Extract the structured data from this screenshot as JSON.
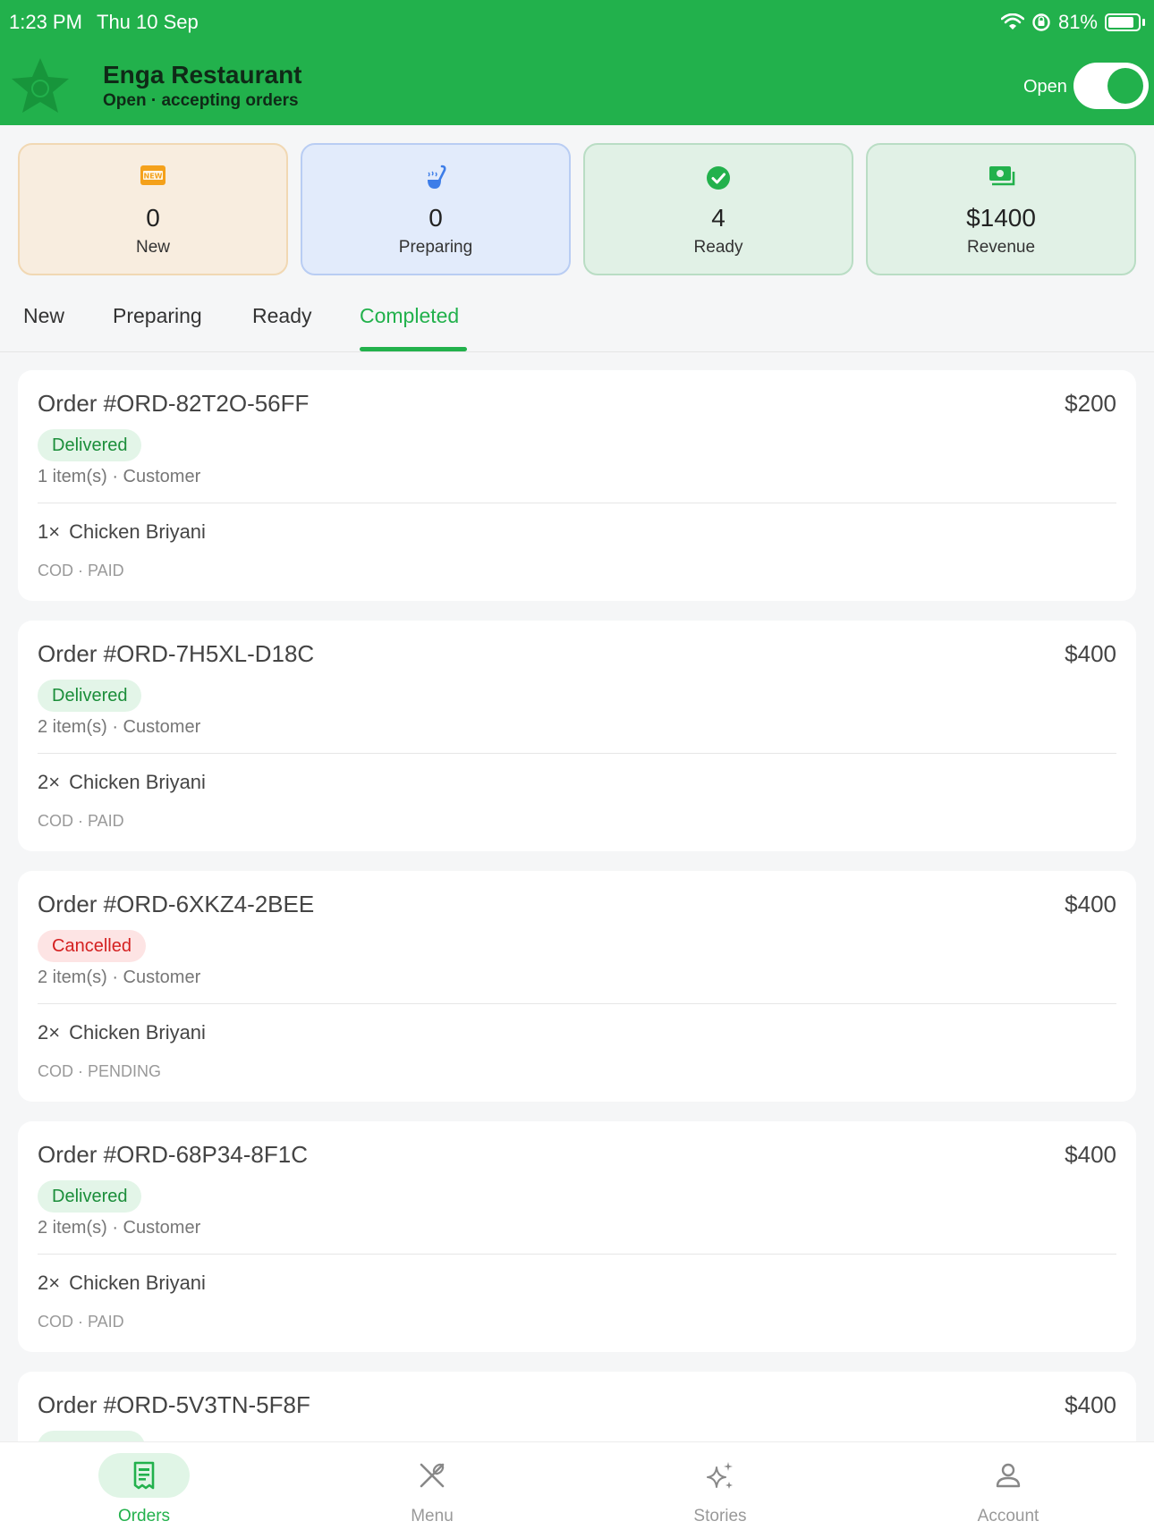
{
  "status_bar": {
    "time": "1:23 PM",
    "date": "Thu 10 Sep",
    "battery": "81%"
  },
  "header": {
    "name": "Enga Restaurant",
    "subtitle": "Open · accepting orders",
    "toggle_label": "Open",
    "toggle_on": true
  },
  "stats": [
    {
      "value": "0",
      "label": "New",
      "icon": "new-badge-icon",
      "bg": "#f8eddf",
      "border": "#f1d8b3"
    },
    {
      "value": "0",
      "label": "Preparing",
      "icon": "ladle-icon",
      "bg": "#e2ebfb",
      "border": "#b9cdf3"
    },
    {
      "value": "4",
      "label": "Ready",
      "icon": "check-circle-icon",
      "bg": "#e1f1e6",
      "border": "#b9ddc4"
    },
    {
      "value": "$1400",
      "label": "Revenue",
      "icon": "cash-icon",
      "bg": "#e1f1e6",
      "border": "#b9ddc4"
    }
  ],
  "tabs": [
    {
      "label": "New"
    },
    {
      "label": "Preparing"
    },
    {
      "label": "Ready"
    },
    {
      "label": "Completed",
      "active": true
    }
  ],
  "orders": [
    {
      "title": "Order #ORD-82T2O-56FF",
      "total": "$200",
      "status": "Delivered",
      "meta": "1 item(s) · Customer",
      "qty": "1×",
      "item": "Chicken Briyani",
      "payment": "COD · PAID"
    },
    {
      "title": "Order #ORD-7H5XL-D18C",
      "total": "$400",
      "status": "Delivered",
      "meta": "2 item(s) · Customer",
      "qty": "2×",
      "item": "Chicken Briyani",
      "payment": "COD · PAID"
    },
    {
      "title": "Order #ORD-6XKZ4-2BEE",
      "total": "$400",
      "status": "Cancelled",
      "meta": "2 item(s) · Customer",
      "qty": "2×",
      "item": "Chicken Briyani",
      "payment": "COD · PENDING"
    },
    {
      "title": "Order #ORD-68P34-8F1C",
      "total": "$400",
      "status": "Delivered",
      "meta": "2 item(s) · Customer",
      "qty": "2×",
      "item": "Chicken Briyani",
      "payment": "COD · PAID"
    },
    {
      "title": "Order #ORD-5V3TN-5F8F",
      "total": "$400"
    }
  ],
  "bottom_nav": [
    {
      "label": "Orders",
      "icon": "receipt-icon",
      "active": true
    },
    {
      "label": "Menu",
      "icon": "utensils-icon"
    },
    {
      "label": "Stories",
      "icon": "sparkle-icon"
    },
    {
      "label": "Account",
      "icon": "person-icon"
    }
  ],
  "colors": {
    "brand": "#22b14c",
    "delivered": "#1b8e3a",
    "cancelled": "#d42020"
  }
}
